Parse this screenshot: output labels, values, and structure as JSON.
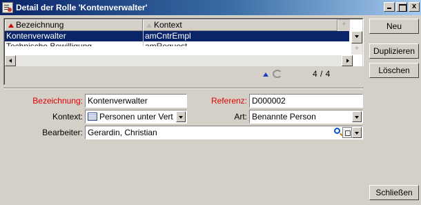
{
  "window": {
    "title": "Detail der Rolle 'Kontenverwalter'",
    "icon": "role-detail-icon",
    "close_glyph": "x"
  },
  "list": {
    "columns": [
      {
        "label": "Bezeichnung",
        "sort": "ascending",
        "sort_color": "#cc0000"
      },
      {
        "label": "Kontext",
        "sort": "none"
      }
    ],
    "add_column_glyph": "+",
    "rows": [
      {
        "bezeichnung": "Kontenverwalter",
        "kontext": "amCntrEmpl",
        "selected": true
      },
      {
        "bezeichnung": "Technische Bewilligung",
        "kontext": "amRequest",
        "selected": false,
        "partially_visible": true
      }
    ],
    "counter": "4 / 4"
  },
  "form": {
    "bezeichnung": {
      "label": "Bezeichnung:",
      "value": "Kontenverwalter",
      "required": true
    },
    "referenz": {
      "label": "Referenz:",
      "value": "D000002",
      "required": true
    },
    "kontext": {
      "label": "Kontext:",
      "value": "Personen unter Vert"
    },
    "art": {
      "label": "Art:",
      "value": "Benannte Person"
    },
    "bearbeiter": {
      "label": "Bearbeiter:",
      "value": "Gerardin, Christian"
    }
  },
  "buttons": {
    "neu": "Neu",
    "duplizieren": "Duplizieren",
    "loeschen": "Löschen",
    "schliessen": "Schließen"
  },
  "colors": {
    "title_gradient_start": "#0a246a",
    "title_gradient_end": "#a6caf0",
    "selection": "#0a246a",
    "required_label": "#e00000",
    "window_bg": "#d4d0c8"
  }
}
